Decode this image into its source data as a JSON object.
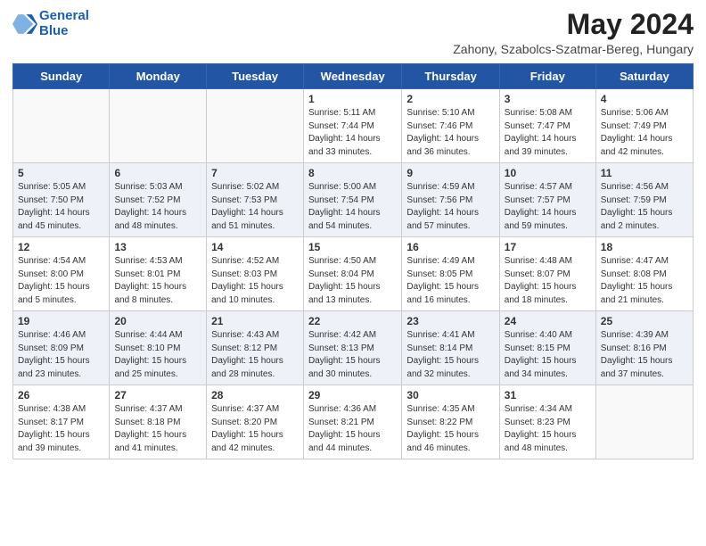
{
  "header": {
    "logo_line1": "General",
    "logo_line2": "Blue",
    "month_title": "May 2024",
    "subtitle": "Zahony, Szabolcs-Szatmar-Bereg, Hungary"
  },
  "days_of_week": [
    "Sunday",
    "Monday",
    "Tuesday",
    "Wednesday",
    "Thursday",
    "Friday",
    "Saturday"
  ],
  "weeks": [
    [
      {
        "day": "",
        "info": ""
      },
      {
        "day": "",
        "info": ""
      },
      {
        "day": "",
        "info": ""
      },
      {
        "day": "1",
        "info": "Sunrise: 5:11 AM\nSunset: 7:44 PM\nDaylight: 14 hours\nand 33 minutes."
      },
      {
        "day": "2",
        "info": "Sunrise: 5:10 AM\nSunset: 7:46 PM\nDaylight: 14 hours\nand 36 minutes."
      },
      {
        "day": "3",
        "info": "Sunrise: 5:08 AM\nSunset: 7:47 PM\nDaylight: 14 hours\nand 39 minutes."
      },
      {
        "day": "4",
        "info": "Sunrise: 5:06 AM\nSunset: 7:49 PM\nDaylight: 14 hours\nand 42 minutes."
      }
    ],
    [
      {
        "day": "5",
        "info": "Sunrise: 5:05 AM\nSunset: 7:50 PM\nDaylight: 14 hours\nand 45 minutes."
      },
      {
        "day": "6",
        "info": "Sunrise: 5:03 AM\nSunset: 7:52 PM\nDaylight: 14 hours\nand 48 minutes."
      },
      {
        "day": "7",
        "info": "Sunrise: 5:02 AM\nSunset: 7:53 PM\nDaylight: 14 hours\nand 51 minutes."
      },
      {
        "day": "8",
        "info": "Sunrise: 5:00 AM\nSunset: 7:54 PM\nDaylight: 14 hours\nand 54 minutes."
      },
      {
        "day": "9",
        "info": "Sunrise: 4:59 AM\nSunset: 7:56 PM\nDaylight: 14 hours\nand 57 minutes."
      },
      {
        "day": "10",
        "info": "Sunrise: 4:57 AM\nSunset: 7:57 PM\nDaylight: 14 hours\nand 59 minutes."
      },
      {
        "day": "11",
        "info": "Sunrise: 4:56 AM\nSunset: 7:59 PM\nDaylight: 15 hours\nand 2 minutes."
      }
    ],
    [
      {
        "day": "12",
        "info": "Sunrise: 4:54 AM\nSunset: 8:00 PM\nDaylight: 15 hours\nand 5 minutes."
      },
      {
        "day": "13",
        "info": "Sunrise: 4:53 AM\nSunset: 8:01 PM\nDaylight: 15 hours\nand 8 minutes."
      },
      {
        "day": "14",
        "info": "Sunrise: 4:52 AM\nSunset: 8:03 PM\nDaylight: 15 hours\nand 10 minutes."
      },
      {
        "day": "15",
        "info": "Sunrise: 4:50 AM\nSunset: 8:04 PM\nDaylight: 15 hours\nand 13 minutes."
      },
      {
        "day": "16",
        "info": "Sunrise: 4:49 AM\nSunset: 8:05 PM\nDaylight: 15 hours\nand 16 minutes."
      },
      {
        "day": "17",
        "info": "Sunrise: 4:48 AM\nSunset: 8:07 PM\nDaylight: 15 hours\nand 18 minutes."
      },
      {
        "day": "18",
        "info": "Sunrise: 4:47 AM\nSunset: 8:08 PM\nDaylight: 15 hours\nand 21 minutes."
      }
    ],
    [
      {
        "day": "19",
        "info": "Sunrise: 4:46 AM\nSunset: 8:09 PM\nDaylight: 15 hours\nand 23 minutes."
      },
      {
        "day": "20",
        "info": "Sunrise: 4:44 AM\nSunset: 8:10 PM\nDaylight: 15 hours\nand 25 minutes."
      },
      {
        "day": "21",
        "info": "Sunrise: 4:43 AM\nSunset: 8:12 PM\nDaylight: 15 hours\nand 28 minutes."
      },
      {
        "day": "22",
        "info": "Sunrise: 4:42 AM\nSunset: 8:13 PM\nDaylight: 15 hours\nand 30 minutes."
      },
      {
        "day": "23",
        "info": "Sunrise: 4:41 AM\nSunset: 8:14 PM\nDaylight: 15 hours\nand 32 minutes."
      },
      {
        "day": "24",
        "info": "Sunrise: 4:40 AM\nSunset: 8:15 PM\nDaylight: 15 hours\nand 34 minutes."
      },
      {
        "day": "25",
        "info": "Sunrise: 4:39 AM\nSunset: 8:16 PM\nDaylight: 15 hours\nand 37 minutes."
      }
    ],
    [
      {
        "day": "26",
        "info": "Sunrise: 4:38 AM\nSunset: 8:17 PM\nDaylight: 15 hours\nand 39 minutes."
      },
      {
        "day": "27",
        "info": "Sunrise: 4:37 AM\nSunset: 8:18 PM\nDaylight: 15 hours\nand 41 minutes."
      },
      {
        "day": "28",
        "info": "Sunrise: 4:37 AM\nSunset: 8:20 PM\nDaylight: 15 hours\nand 42 minutes."
      },
      {
        "day": "29",
        "info": "Sunrise: 4:36 AM\nSunset: 8:21 PM\nDaylight: 15 hours\nand 44 minutes."
      },
      {
        "day": "30",
        "info": "Sunrise: 4:35 AM\nSunset: 8:22 PM\nDaylight: 15 hours\nand 46 minutes."
      },
      {
        "day": "31",
        "info": "Sunrise: 4:34 AM\nSunset: 8:23 PM\nDaylight: 15 hours\nand 48 minutes."
      },
      {
        "day": "",
        "info": ""
      }
    ]
  ]
}
